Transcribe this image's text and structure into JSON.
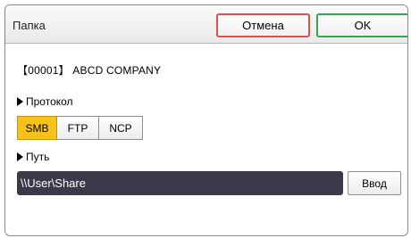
{
  "header": {
    "title": "Папка",
    "cancel_label": "Отмена",
    "ok_label": "OK"
  },
  "destination": {
    "company": "【00001】 ABCD COMPANY"
  },
  "protocol": {
    "label": "Протокол",
    "options": [
      "SMB",
      "FTP",
      "NCP"
    ],
    "selected": "SMB"
  },
  "path": {
    "label": "Путь",
    "value": "\\\\User\\Share",
    "enter_label": "Ввод"
  },
  "colors": {
    "selected_accent": "#f7c31b",
    "cancel_border": "#d9534f",
    "ok_border": "#35a64b",
    "path_field_bg": "#3a3a4a"
  },
  "icons": {
    "section_marker": "triangle-right-icon"
  }
}
